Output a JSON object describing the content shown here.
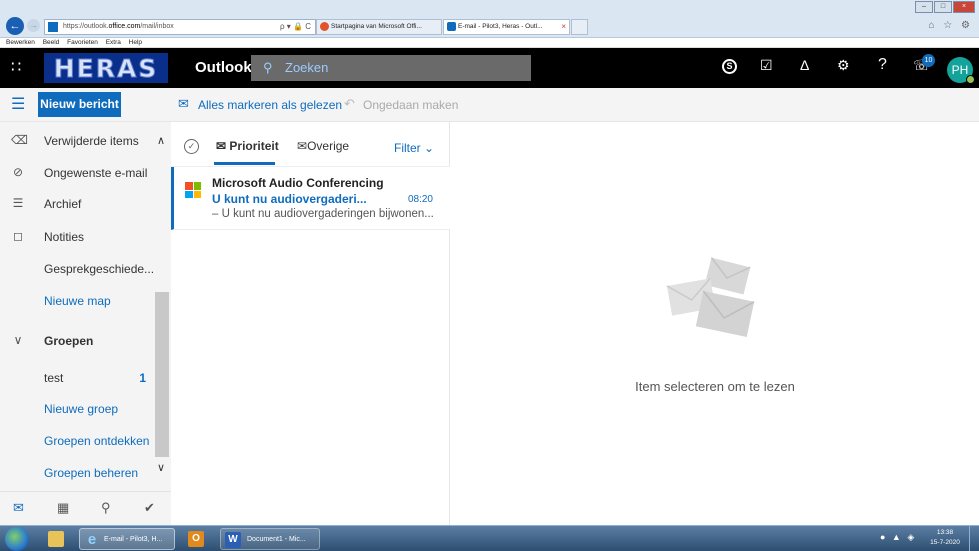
{
  "browser": {
    "url_prefix": "https://outlook.",
    "url_domain": "office.com",
    "url_path": "/mail/inbox",
    "address_controls": "ρ ▾ 🔒 C",
    "tabs": [
      {
        "label": "Startpagina van Microsoft Offi..."
      },
      {
        "label": "E-mail - Pilot3, Heras - Outl...",
        "close": "×"
      }
    ],
    "menu": [
      "Bewerken",
      "Beeld",
      "Favorieten",
      "Extra",
      "Help"
    ],
    "icons": "⌂ ☆ ⚙"
  },
  "header": {
    "logo": "HERAS",
    "app_name": "Outlook",
    "search_placeholder": "Zoeken",
    "notification_count": "10",
    "avatar_initials": "PH",
    "icons": {
      "apps": "∷",
      "skype": "S",
      "todo": "☑",
      "bell": "Δ",
      "gear": "⚙",
      "help": "?",
      "feedback": "☏"
    }
  },
  "command_bar": {
    "new_message": "Nieuw bericht",
    "mark_all_read": "Alles markeren als gelezen",
    "undo": "Ongedaan maken"
  },
  "sidebar": {
    "items": [
      {
        "label": "Verwijderde items",
        "icon": "trash-icon",
        "glyph": "⌫"
      },
      {
        "label": "Ongewenste e-mail",
        "icon": "block-icon",
        "glyph": "⊘"
      },
      {
        "label": "Archief",
        "icon": "archive-icon",
        "glyph": "☰"
      },
      {
        "label": "Notities",
        "icon": "note-icon",
        "glyph": "◻"
      },
      {
        "label": "Gesprekgeschiede...",
        "icon": "",
        "glyph": ""
      },
      {
        "label": "Nieuwe map",
        "icon": "",
        "glyph": ""
      }
    ],
    "groups_header": "Groepen",
    "groups": [
      {
        "label": "test",
        "count": "1"
      },
      {
        "label": "Nieuwe groep"
      },
      {
        "label": "Groepen ontdekken"
      },
      {
        "label": "Groepen beheren"
      }
    ]
  },
  "message_list": {
    "tab_priority": "Prioriteit",
    "tab_other": "Overige",
    "filter": "Filter",
    "messages": [
      {
        "sender": "Microsoft Audio Conferencing",
        "subject": "U kunt nu audiovergaderi...",
        "time": "08:20",
        "preview": "– U kunt nu audiovergaderingen bijwonen..."
      }
    ]
  },
  "reading_pane": {
    "empty_text": "Item selecteren om te lezen"
  },
  "taskbar": {
    "ie_label": "E-mail - Pilot3, H...",
    "word_label": "Document1 - Mic...",
    "time": "13:38",
    "date": "15-7-2020"
  },
  "colors": {
    "accent": "#0f6cbd",
    "header_bg": "#000000",
    "logo_bg": "#0a2f8a",
    "avatar": "#13a39a"
  }
}
